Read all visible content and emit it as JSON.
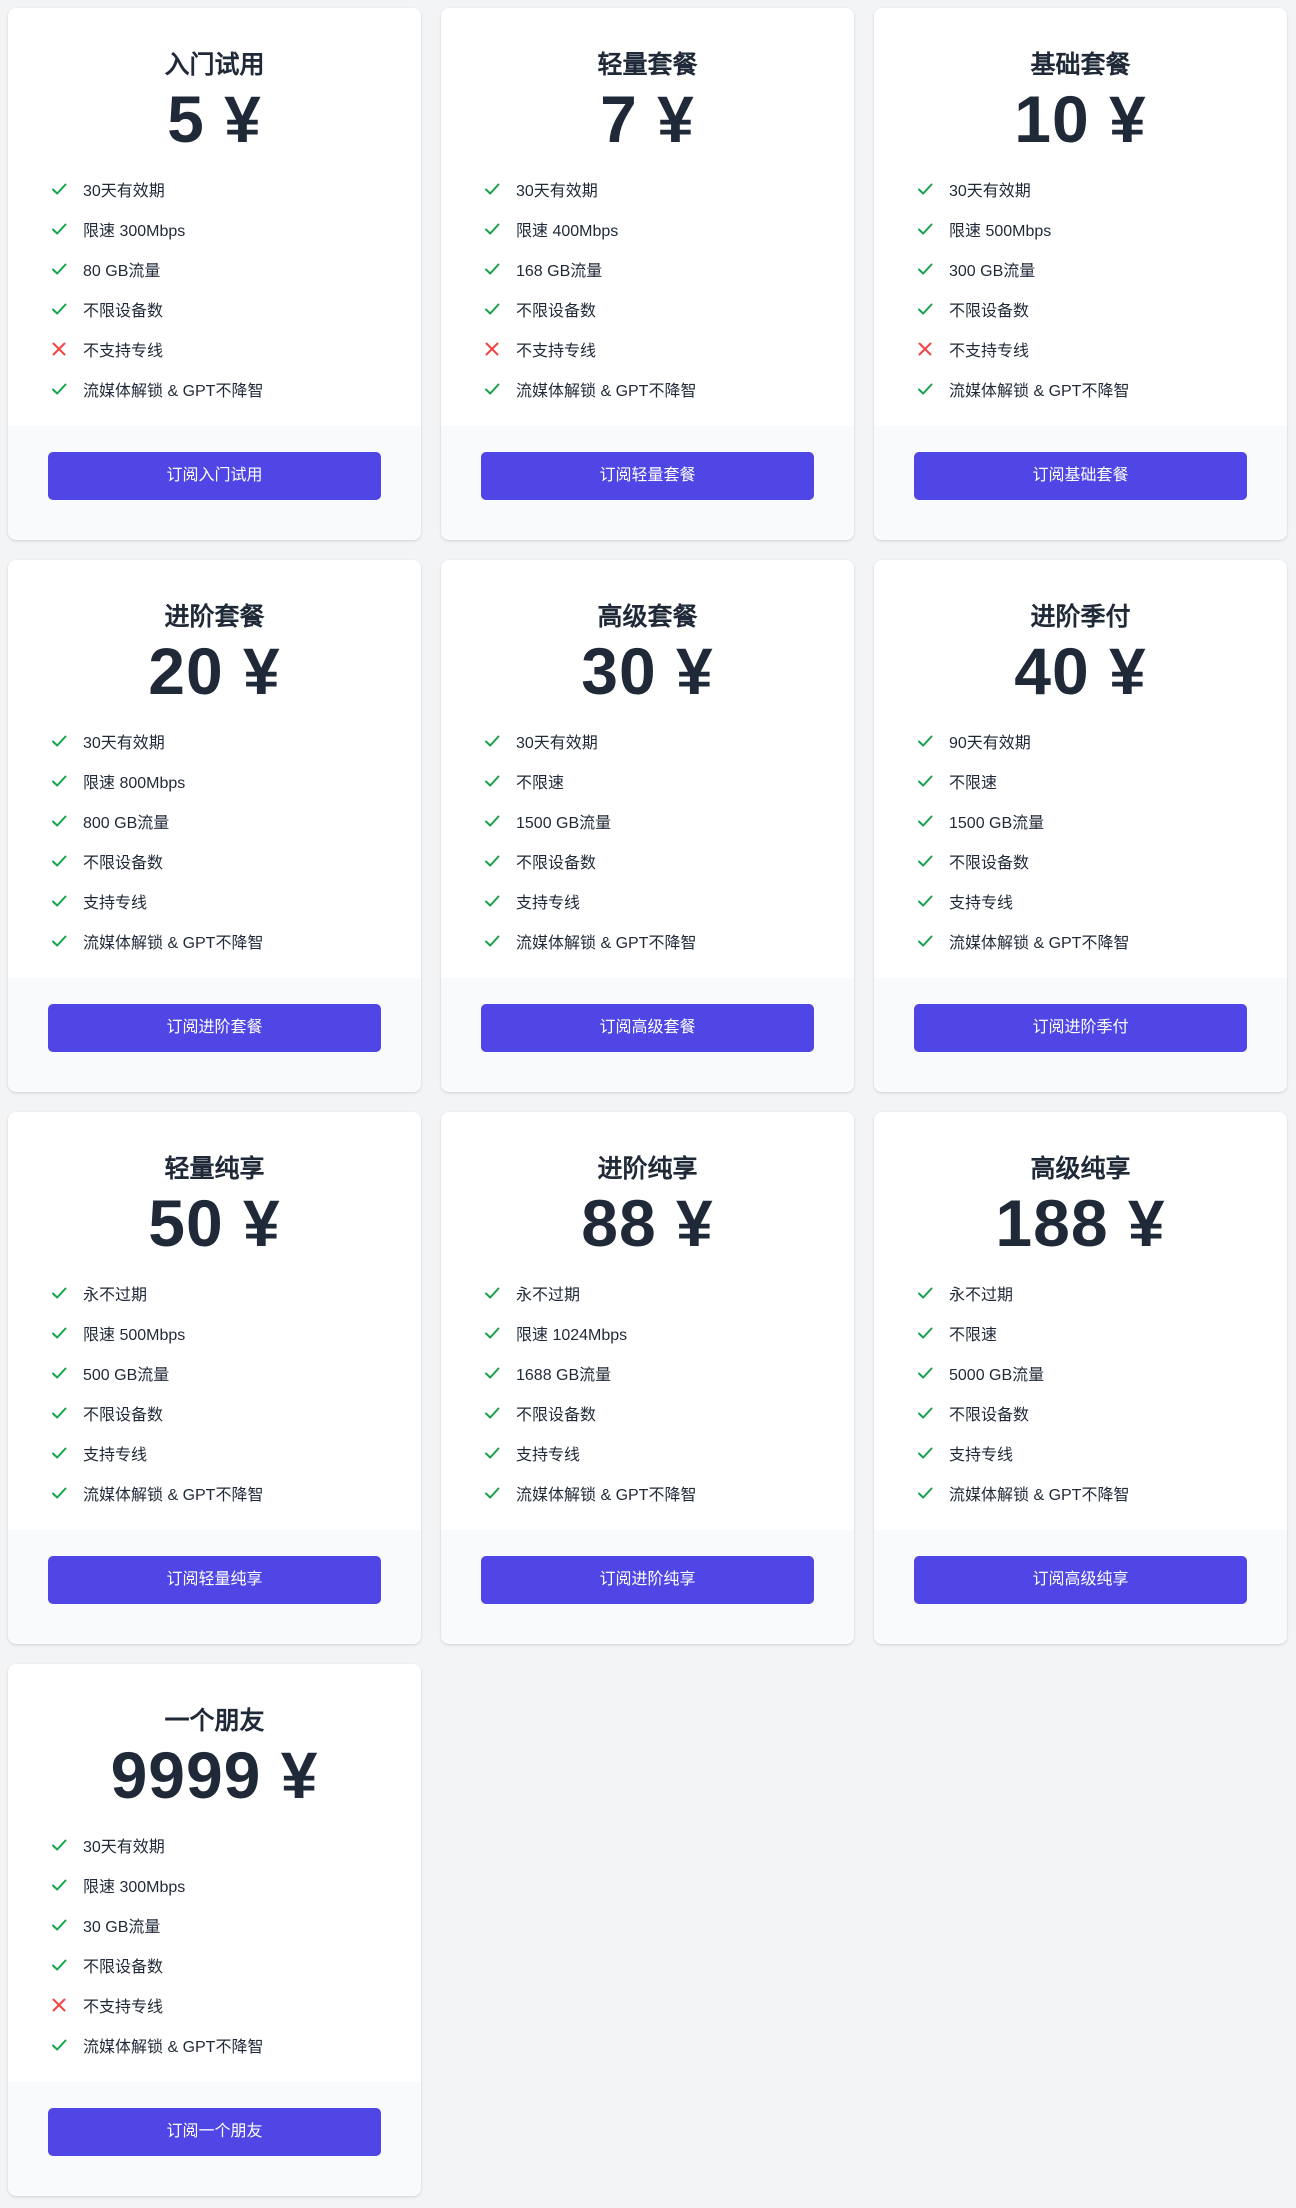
{
  "colors": {
    "page_background": "#f3f4f6",
    "card_background": "#ffffff",
    "card_footer_background": "#f9fafb",
    "text": "#1f2937",
    "button": "#4f46e5",
    "button_text": "#ffffff",
    "check": "#16a34a",
    "cross": "#ef4444"
  },
  "icons": {
    "yes": "check-icon",
    "no": "cross-icon"
  },
  "plans": [
    {
      "name": "入门试用",
      "price": "5 ¥",
      "button": "订阅入门试用",
      "features": [
        {
          "text": "30天有效期",
          "ok": true
        },
        {
          "text": "限速 300Mbps",
          "ok": true
        },
        {
          "text": "80 GB流量",
          "ok": true
        },
        {
          "text": "不限设备数",
          "ok": true
        },
        {
          "text": "不支持专线",
          "ok": false
        },
        {
          "text": "流媒体解锁 & GPT不降智",
          "ok": true
        }
      ]
    },
    {
      "name": "轻量套餐",
      "price": "7 ¥",
      "button": "订阅轻量套餐",
      "features": [
        {
          "text": "30天有效期",
          "ok": true
        },
        {
          "text": "限速 400Mbps",
          "ok": true
        },
        {
          "text": "168 GB流量",
          "ok": true
        },
        {
          "text": "不限设备数",
          "ok": true
        },
        {
          "text": "不支持专线",
          "ok": false
        },
        {
          "text": "流媒体解锁 & GPT不降智",
          "ok": true
        }
      ]
    },
    {
      "name": "基础套餐",
      "price": "10 ¥",
      "button": "订阅基础套餐",
      "features": [
        {
          "text": "30天有效期",
          "ok": true
        },
        {
          "text": "限速 500Mbps",
          "ok": true
        },
        {
          "text": "300 GB流量",
          "ok": true
        },
        {
          "text": "不限设备数",
          "ok": true
        },
        {
          "text": "不支持专线",
          "ok": false
        },
        {
          "text": "流媒体解锁 & GPT不降智",
          "ok": true
        }
      ]
    },
    {
      "name": "进阶套餐",
      "price": "20 ¥",
      "button": "订阅进阶套餐",
      "features": [
        {
          "text": "30天有效期",
          "ok": true
        },
        {
          "text": "限速 800Mbps",
          "ok": true
        },
        {
          "text": "800 GB流量",
          "ok": true
        },
        {
          "text": "不限设备数",
          "ok": true
        },
        {
          "text": "支持专线",
          "ok": true
        },
        {
          "text": "流媒体解锁 & GPT不降智",
          "ok": true
        }
      ]
    },
    {
      "name": "高级套餐",
      "price": "30 ¥",
      "button": "订阅高级套餐",
      "features": [
        {
          "text": "30天有效期",
          "ok": true
        },
        {
          "text": "不限速",
          "ok": true
        },
        {
          "text": "1500 GB流量",
          "ok": true
        },
        {
          "text": "不限设备数",
          "ok": true
        },
        {
          "text": "支持专线",
          "ok": true
        },
        {
          "text": "流媒体解锁 & GPT不降智",
          "ok": true
        }
      ]
    },
    {
      "name": "进阶季付",
      "price": "40 ¥",
      "button": "订阅进阶季付",
      "features": [
        {
          "text": "90天有效期",
          "ok": true
        },
        {
          "text": "不限速",
          "ok": true
        },
        {
          "text": "1500 GB流量",
          "ok": true
        },
        {
          "text": "不限设备数",
          "ok": true
        },
        {
          "text": "支持专线",
          "ok": true
        },
        {
          "text": "流媒体解锁 & GPT不降智",
          "ok": true
        }
      ]
    },
    {
      "name": "轻量纯享",
      "price": "50 ¥",
      "button": "订阅轻量纯享",
      "features": [
        {
          "text": "永不过期",
          "ok": true
        },
        {
          "text": "限速 500Mbps",
          "ok": true
        },
        {
          "text": "500 GB流量",
          "ok": true
        },
        {
          "text": "不限设备数",
          "ok": true
        },
        {
          "text": "支持专线",
          "ok": true
        },
        {
          "text": "流媒体解锁 & GPT不降智",
          "ok": true
        }
      ]
    },
    {
      "name": "进阶纯享",
      "price": "88 ¥",
      "button": "订阅进阶纯享",
      "features": [
        {
          "text": "永不过期",
          "ok": true
        },
        {
          "text": "限速 1024Mbps",
          "ok": true
        },
        {
          "text": "1688 GB流量",
          "ok": true
        },
        {
          "text": "不限设备数",
          "ok": true
        },
        {
          "text": "支持专线",
          "ok": true
        },
        {
          "text": "流媒体解锁 & GPT不降智",
          "ok": true
        }
      ]
    },
    {
      "name": "高级纯享",
      "price": "188 ¥",
      "button": "订阅高级纯享",
      "features": [
        {
          "text": "永不过期",
          "ok": true
        },
        {
          "text": "不限速",
          "ok": true
        },
        {
          "text": "5000 GB流量",
          "ok": true
        },
        {
          "text": "不限设备数",
          "ok": true
        },
        {
          "text": "支持专线",
          "ok": true
        },
        {
          "text": "流媒体解锁 & GPT不降智",
          "ok": true
        }
      ]
    },
    {
      "name": "一个朋友",
      "price": "9999 ¥",
      "button": "订阅一个朋友",
      "features": [
        {
          "text": "30天有效期",
          "ok": true
        },
        {
          "text": "限速 300Mbps",
          "ok": true
        },
        {
          "text": "30 GB流量",
          "ok": true
        },
        {
          "text": "不限设备数",
          "ok": true
        },
        {
          "text": "不支持专线",
          "ok": false
        },
        {
          "text": "流媒体解锁 & GPT不降智",
          "ok": true
        }
      ]
    }
  ]
}
